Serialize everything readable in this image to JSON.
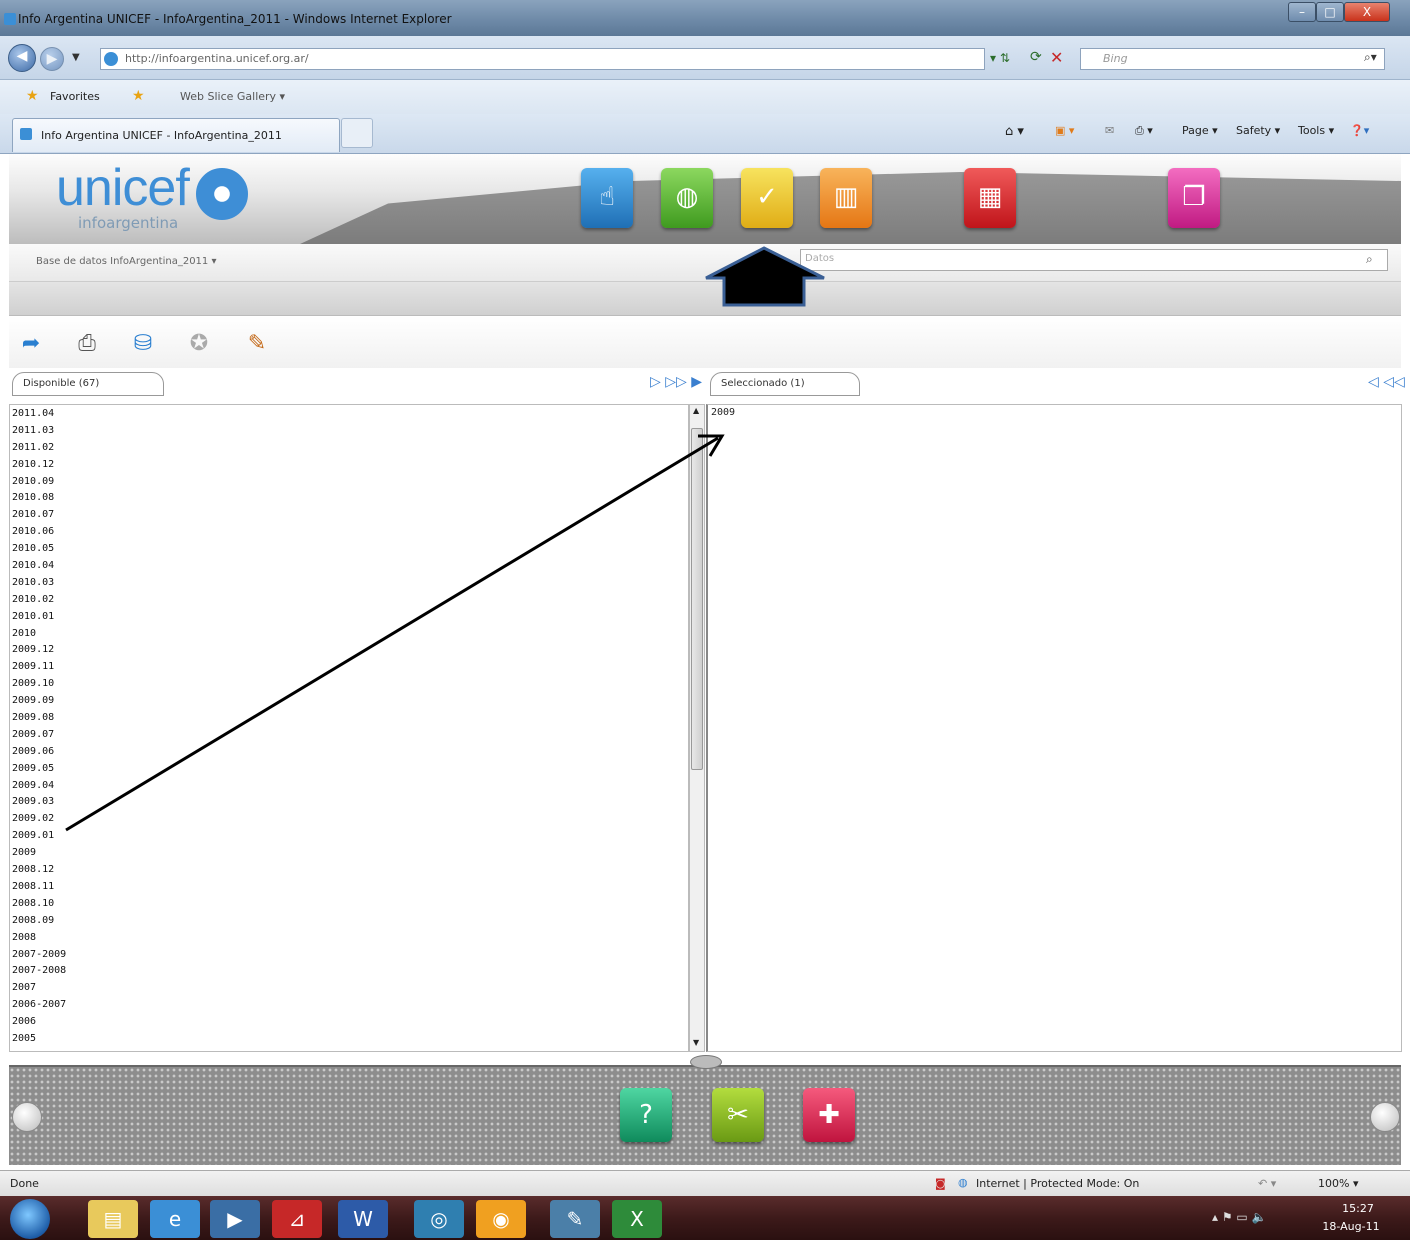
{
  "window": {
    "title": "Info Argentina UNICEF - InfoArgentina_2011 - Windows Internet Explorer",
    "min": "–",
    "max": "□",
    "close": "X"
  },
  "address": {
    "url": "http://infoargentina.unicef.org.ar/",
    "search_placeholder": "Bing"
  },
  "favorites": {
    "label": "Favorites",
    "slice": "Web Slice Gallery ▾"
  },
  "tab": {
    "title": "Info Argentina UNICEF - InfoArgentina_2011"
  },
  "commands": {
    "page": "Page ▾",
    "safety": "Safety ▾",
    "tools": "Tools ▾"
  },
  "brand": {
    "logo": "unicef",
    "sub": "infoargentina"
  },
  "nav_icons": [
    {
      "name": "touch-icon",
      "color": "#1f7fc7"
    },
    {
      "name": "globe-icon",
      "color": "#4caf2e"
    },
    {
      "name": "check-icon",
      "color": "#e7c22a"
    },
    {
      "name": "bars-icon",
      "color": "#f08a1e"
    },
    {
      "name": "grid-icon",
      "color": "#d8262e"
    },
    {
      "name": "windows-icon",
      "color": "#d8248f"
    }
  ],
  "database": {
    "label": "Base de datos",
    "value": "InfoArgentina_2011 ▾"
  },
  "datos_placeholder": "Datos",
  "left_panel": {
    "header": "Disponible (67)",
    "items": [
      "2011.04",
      "2011.03",
      "2011.02",
      "2010.12",
      "2010.09",
      "2010.08",
      "2010.07",
      "2010.06",
      "2010.05",
      "2010.04",
      "2010.03",
      "2010.02",
      "2010.01",
      "2010",
      "2009.12",
      "2009.11",
      "2009.10",
      "2009.09",
      "2009.08",
      "2009.07",
      "2009.06",
      "2009.05",
      "2009.04",
      "2009.03",
      "2009.02",
      "2009.01",
      "2009",
      "2008.12",
      "2008.11",
      "2008.10",
      "2008.09",
      "2008",
      "2007-2009",
      "2007-2008",
      "2007",
      "2006-2007",
      "2006",
      "2005"
    ]
  },
  "right_panel": {
    "header": "Seleccionado (1)",
    "items": [
      "2009"
    ]
  },
  "status": {
    "left": "Done",
    "zone": "Internet | Protected Mode: On",
    "zoom": "100% ▾"
  },
  "clock": {
    "time": "15:27",
    "date": "18-Aug-11"
  }
}
